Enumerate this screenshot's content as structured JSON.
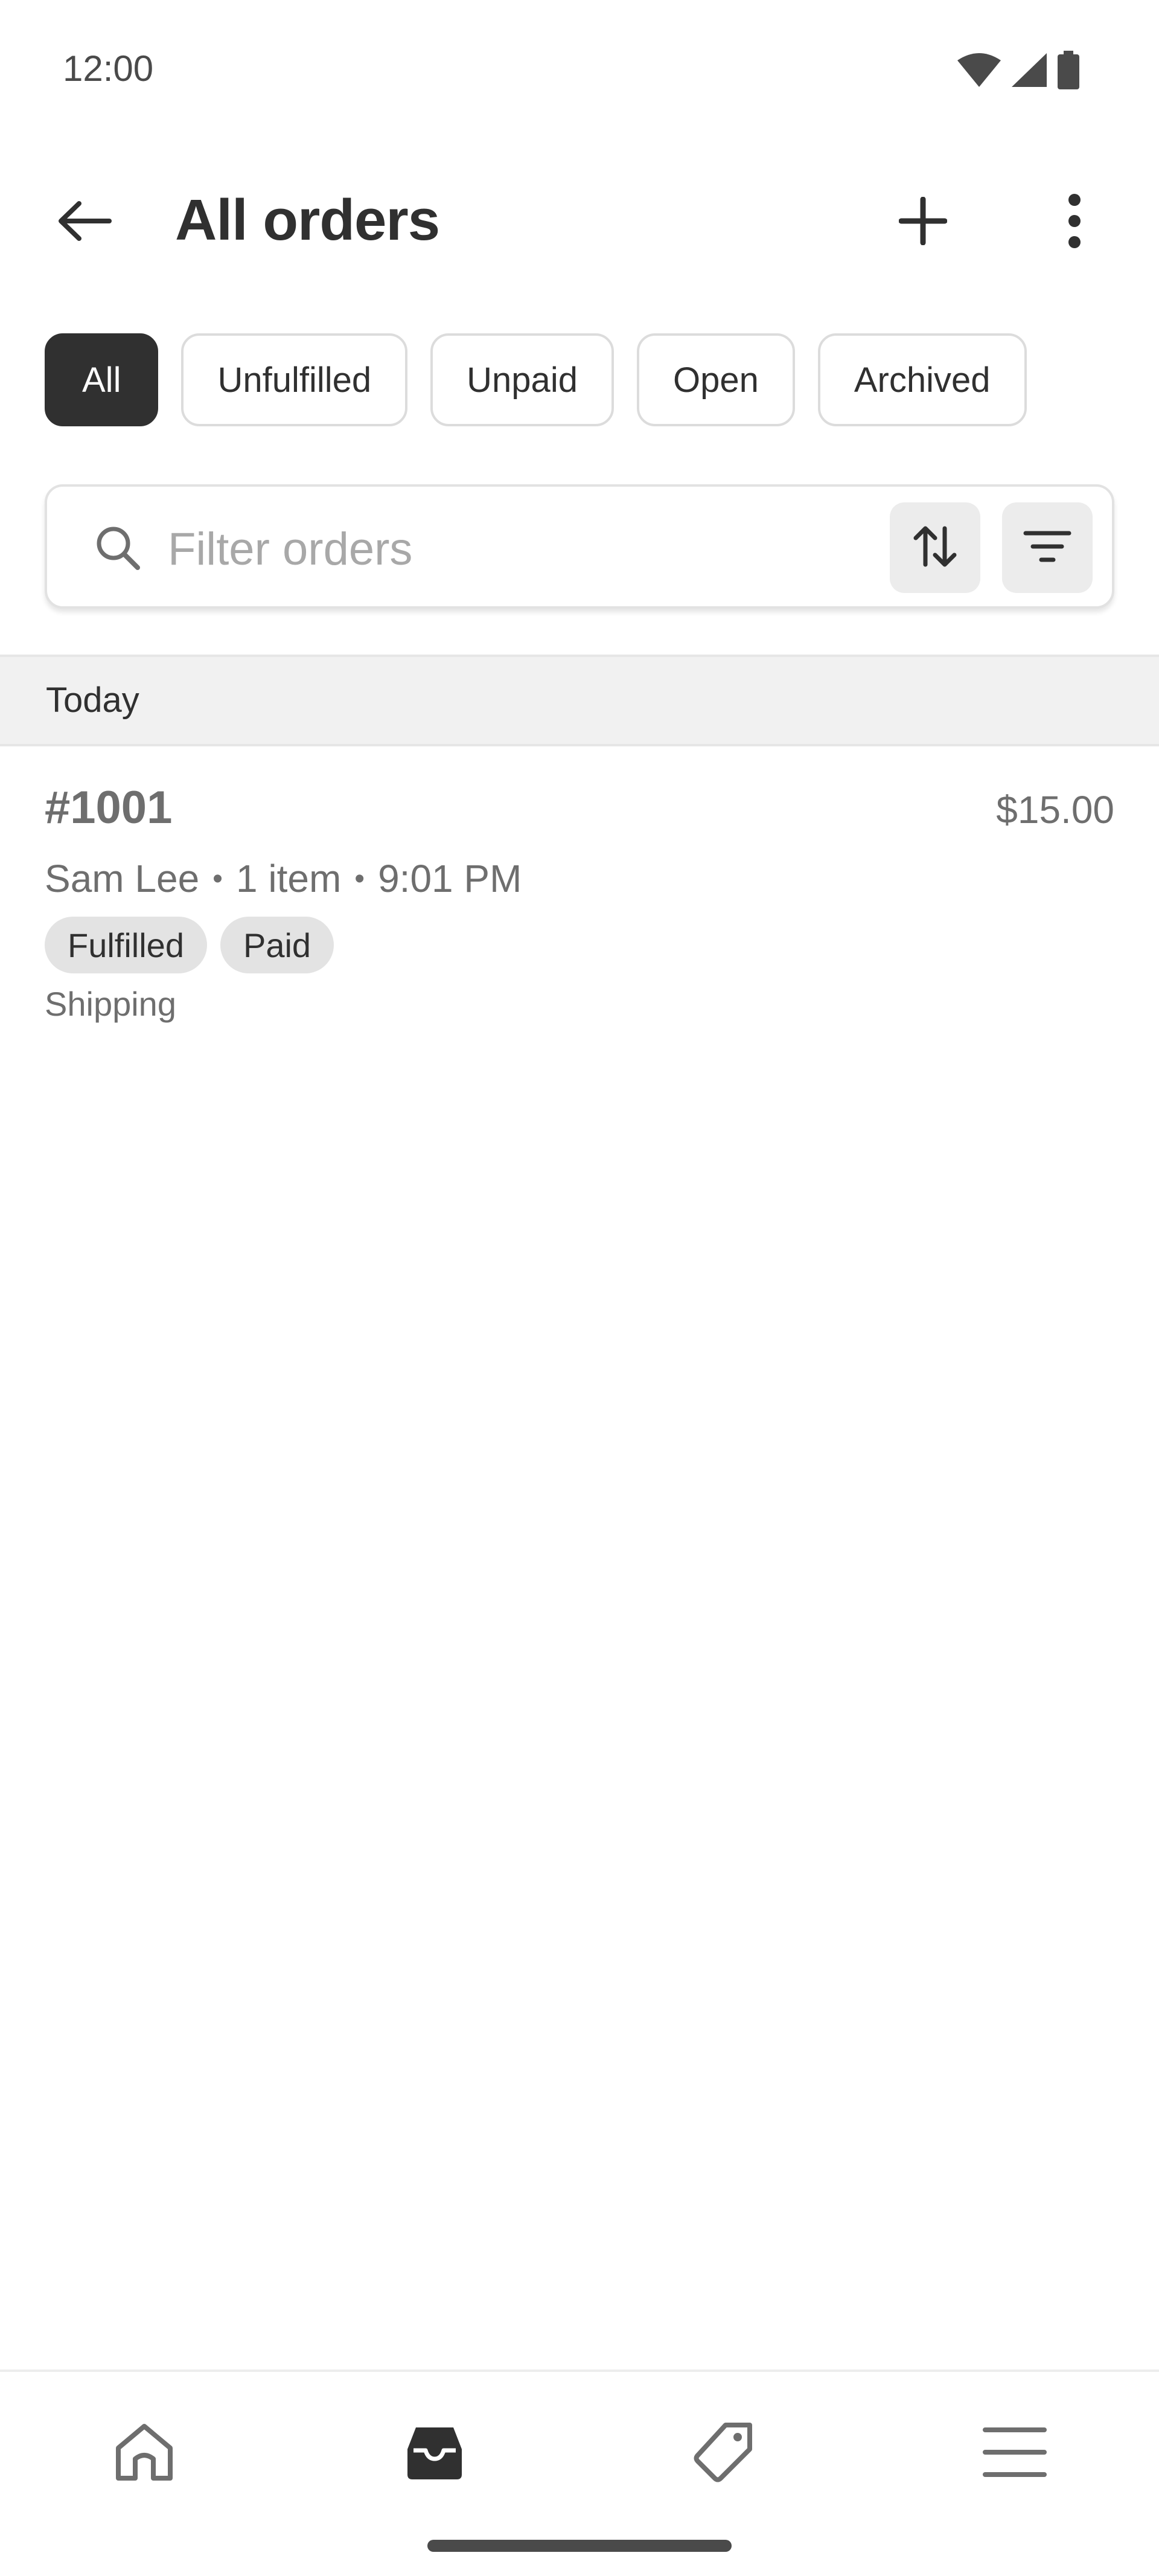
{
  "status_bar": {
    "time": "12:00",
    "icons": [
      "wifi-icon",
      "cellular-signal-icon",
      "battery-icon"
    ]
  },
  "header": {
    "title": "All orders",
    "back_icon": "arrow-left-icon",
    "add_icon": "plus-icon",
    "more_icon": "more-vertical-icon"
  },
  "filter_tabs": [
    {
      "label": "All",
      "selected": true
    },
    {
      "label": "Unfulfilled",
      "selected": false
    },
    {
      "label": "Unpaid",
      "selected": false
    },
    {
      "label": "Open",
      "selected": false
    },
    {
      "label": "Archived",
      "selected": false
    }
  ],
  "search": {
    "placeholder": "Filter orders",
    "value": "",
    "search_icon": "search-icon",
    "sort_icon": "sort-arrows-icon",
    "filter_icon": "filter-lines-icon"
  },
  "sections": [
    {
      "title": "Today",
      "orders": [
        {
          "number": "#1001",
          "total": "$15.00",
          "customer": "Sam Lee",
          "separator": "•",
          "items": "1 item",
          "time": "9:01 PM",
          "badges": [
            "Fulfilled",
            "Paid"
          ],
          "delivery": "Shipping"
        }
      ]
    }
  ],
  "bottom_nav": {
    "items": [
      {
        "icon": "home-icon",
        "active": false
      },
      {
        "icon": "orders-inbox-icon",
        "active": true
      },
      {
        "icon": "tag-icon",
        "active": false
      },
      {
        "icon": "menu-icon",
        "active": false
      }
    ]
  },
  "colors": {
    "primary_dark": "#303030",
    "muted_text": "#6e6e6e",
    "placeholder": "#a8a8a8",
    "badge_bg": "#e3e3e3",
    "section_bg": "#f1f1f1",
    "border": "#dcdcdc"
  }
}
